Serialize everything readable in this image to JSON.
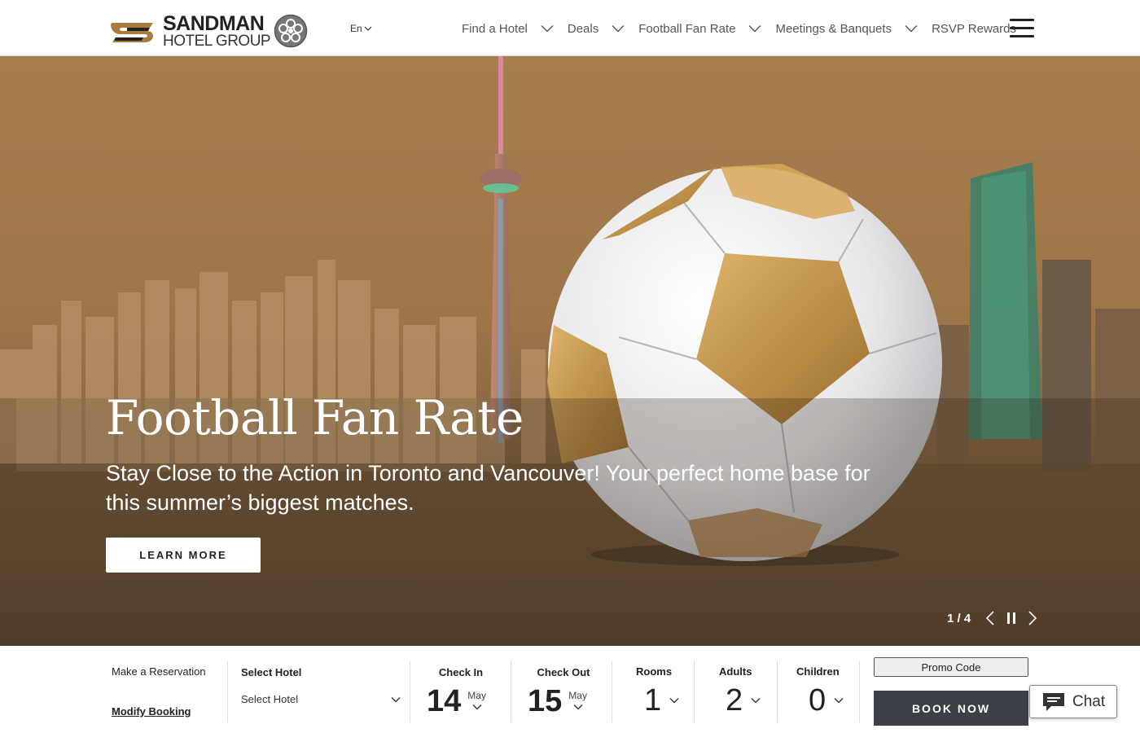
{
  "header": {
    "logo": {
      "line1": "SANDMAN",
      "line2": "HOTEL GROUP"
    },
    "language": "En",
    "nav": [
      {
        "label": "Find a Hotel",
        "has_dropdown": true
      },
      {
        "label": "Deals",
        "has_dropdown": true
      },
      {
        "label": "Football Fan Rate",
        "has_dropdown": true
      },
      {
        "label": "Meetings & Banquets",
        "has_dropdown": true
      },
      {
        "label": "RSVP Rewards",
        "has_dropdown": false
      }
    ]
  },
  "hero": {
    "title": "Football Fan Rate",
    "subtitle": "Stay Close to the Action in Toronto and Vancouver! Your perfect home base for this summer’s biggest matches.",
    "cta_label": "LEARN MORE",
    "slide_counter": "1 / 4"
  },
  "booking": {
    "make_reservation": "Make a Reservation",
    "modify_booking": "Modify Booking",
    "select_hotel_label": "Select Hotel",
    "select_hotel_value": "Select Hotel",
    "check_in": {
      "label": "Check In",
      "day": "14",
      "month": "May"
    },
    "check_out": {
      "label": "Check Out",
      "day": "15",
      "month": "May"
    },
    "rooms": {
      "label": "Rooms",
      "value": "1"
    },
    "adults": {
      "label": "Adults",
      "value": "2"
    },
    "children": {
      "label": "Children",
      "value": "0"
    },
    "promo_code": "Promo Code",
    "book_now": "BOOK NOW"
  },
  "chat": {
    "label": "Chat"
  },
  "colors": {
    "brand_gold": "#a97b3c",
    "book_button": "#3d3f46",
    "hero_tone": "#9a7548"
  }
}
